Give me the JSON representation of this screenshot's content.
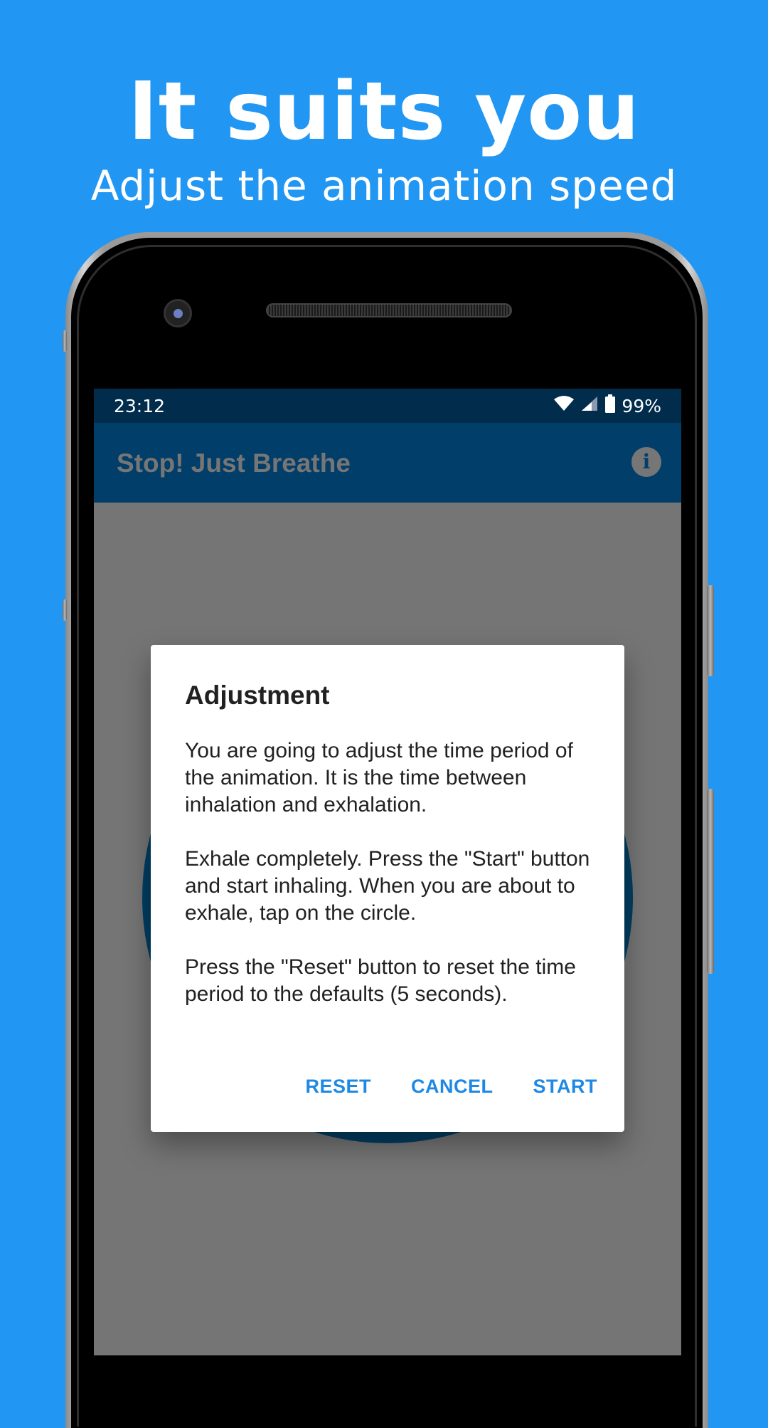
{
  "promo": {
    "title": "It suits you",
    "subtitle": "Adjust the animation speed"
  },
  "status_bar": {
    "time": "23:12",
    "battery": "99%",
    "icons": [
      "wifi-icon",
      "signal-icon",
      "battery-icon"
    ]
  },
  "app_bar": {
    "title": "Stop! Just Breathe",
    "info_icon": "info-icon"
  },
  "dialog": {
    "title": "Adjustment",
    "paragraphs": [
      "You are going to adjust the time period of the animation. It is the time between inhalation and exhalation.",
      "Exhale completely. Press the \"Start\" button and start inhaling. When you are about to exhale, tap on the circle.",
      "Press the \"Reset\" button to reset the time period to the defaults (5 seconds)."
    ],
    "buttons": {
      "reset": "RESET",
      "cancel": "CANCEL",
      "start": "START"
    }
  },
  "colors": {
    "background": "#2196F3",
    "status_bar": "#022c4c",
    "app_bar": "#023e6a",
    "circle": "#023e62",
    "accent": "#1E88E5",
    "scrim": "#757575"
  }
}
